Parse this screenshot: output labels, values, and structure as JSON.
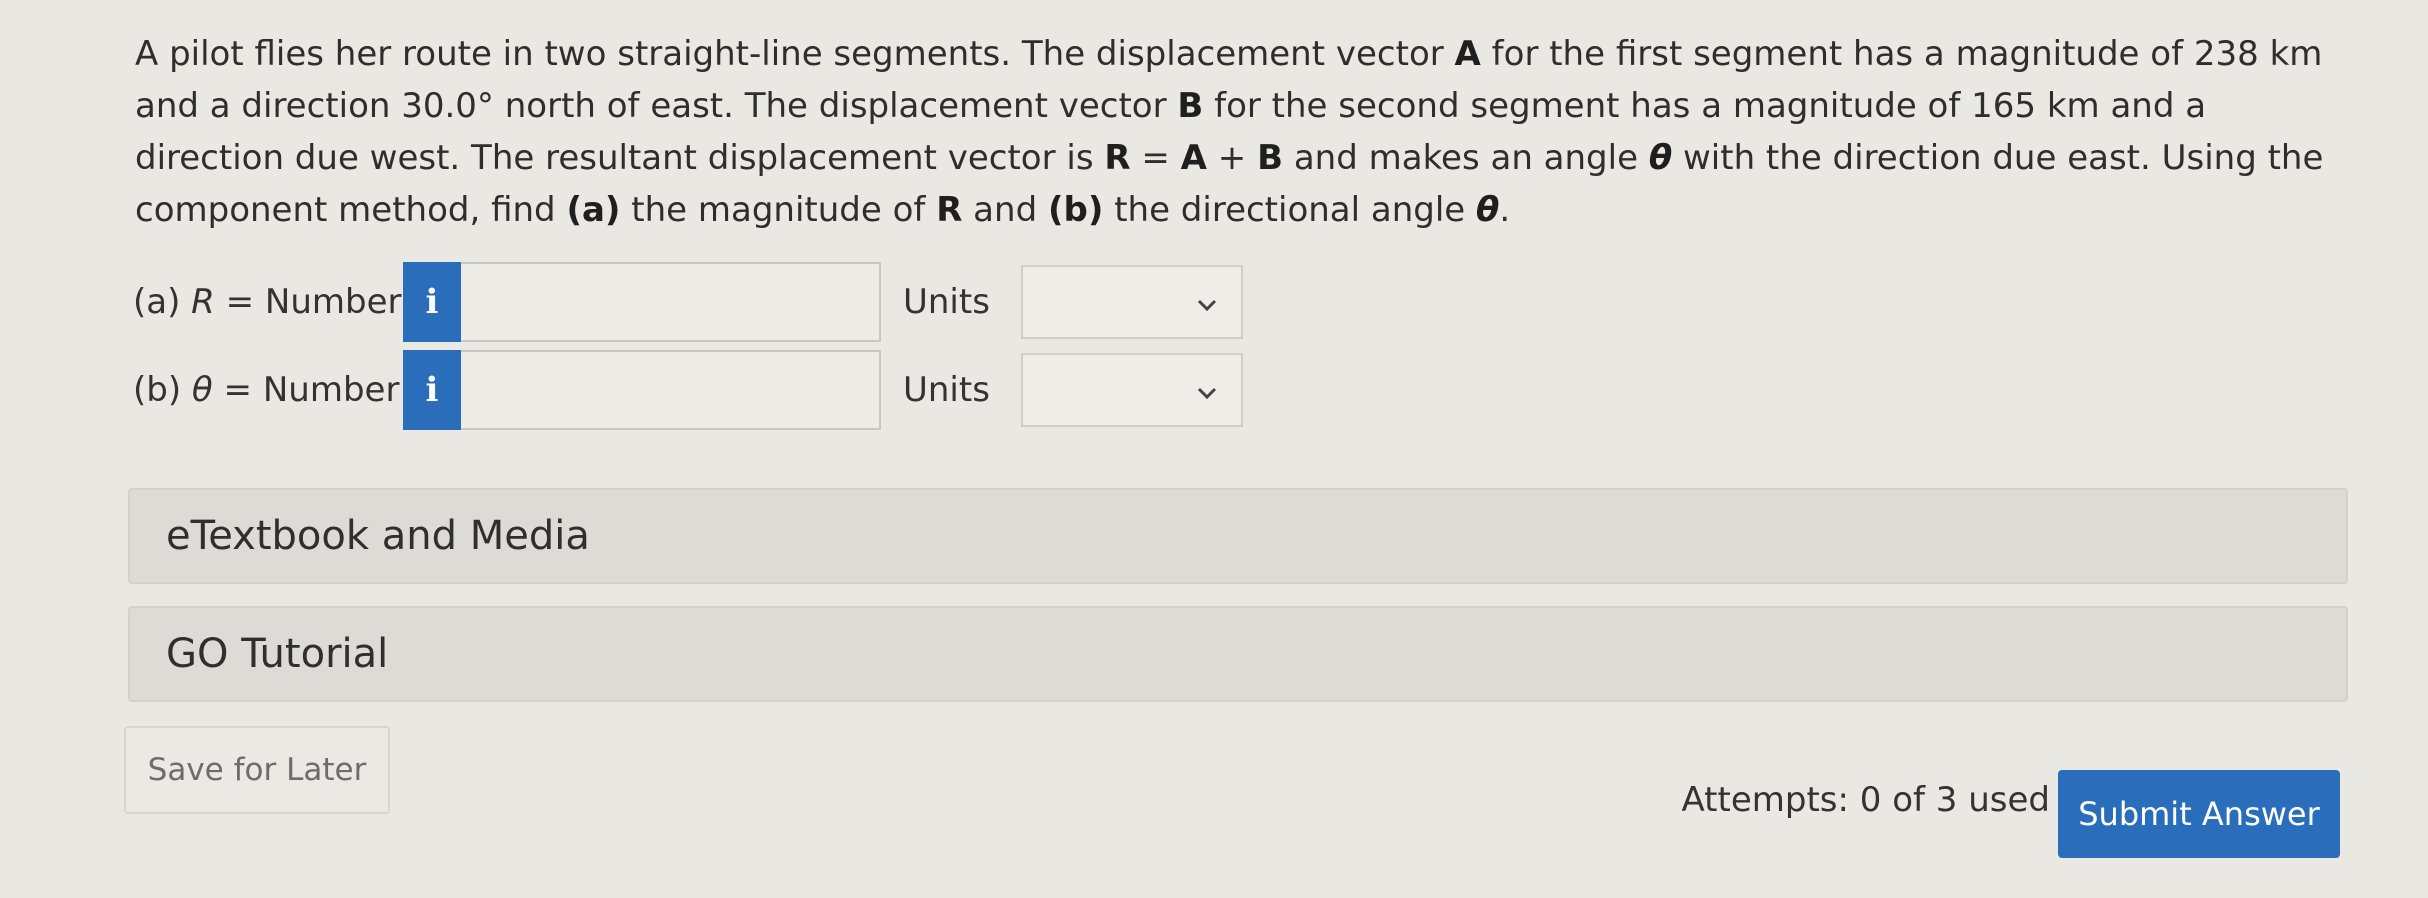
{
  "problem": {
    "part1": "A pilot flies her route in two straight-line segments. The displacement vector ",
    "vecA": "A",
    "part2": " for the first segment has a magnitude of 238 km and a direction 30.0° north of east. The displacement vector ",
    "vecB": "B",
    "part3": " for the second segment has a magnitude of 165 km and a direction due west. The resultant displacement vector is ",
    "eq_R": "R",
    "eq_eq": " = ",
    "eq_A": "A",
    "eq_plus": " + ",
    "eq_B": "B",
    "part4": " and makes an angle ",
    "theta": "θ",
    "part5": " with the direction due east. Using the component method, find ",
    "a_marker": "(a)",
    "part6": " the magnitude of ",
    "vecR": "R",
    "part7": " and ",
    "b_marker": "(b)",
    "part8": " the directional angle ",
    "theta2": "θ",
    "part9": "."
  },
  "answers": [
    {
      "label_prefix": "(a) ",
      "symbol": "R",
      "label_suffix": " = Number",
      "info_icon": "i",
      "value": "",
      "units_label": "Units",
      "units_value": ""
    },
    {
      "label_prefix": "(b) ",
      "symbol": "θ",
      "label_suffix": " = Number",
      "info_icon": "i",
      "value": "",
      "units_label": "Units",
      "units_value": ""
    }
  ],
  "sections": {
    "etextbook": "eTextbook and Media",
    "go_tutorial": "GO Tutorial"
  },
  "footer": {
    "save_label": "Save for Later",
    "attempts": "Attempts: 0 of 3 used",
    "submit_label": "Submit Answer"
  },
  "colors": {
    "accent": "#2a6ebb",
    "background": "#e9e8e2"
  }
}
